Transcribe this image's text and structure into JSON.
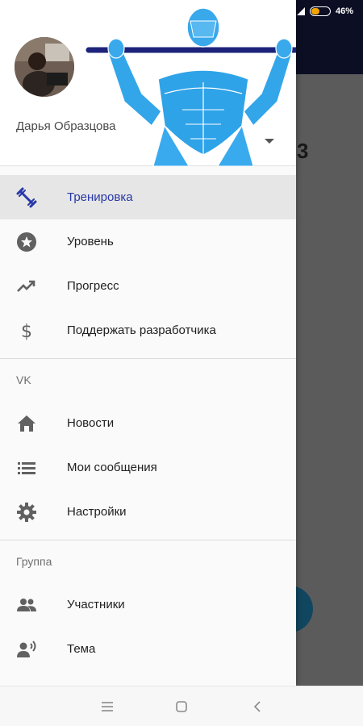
{
  "status_bar": {
    "battery": "46%",
    "battery_level": 0.46
  },
  "background": {
    "partial_number": "3",
    "toolbar_color": "#1d2256",
    "fab_color": "#2aa6e5"
  },
  "drawer": {
    "user_name": "Дарья Образцова",
    "accent_color": "#2838a8",
    "items_main": [
      {
        "label": "Тренировка",
        "icon": "dumbbell-icon",
        "active": true
      },
      {
        "label": "Уровень",
        "icon": "star-circle-icon",
        "active": false
      },
      {
        "label": "Прогресс",
        "icon": "trending-up-icon",
        "active": false
      },
      {
        "label": "Поддержать разработчика",
        "icon": "dollar-icon",
        "active": false
      }
    ],
    "section_vk": "VK",
    "items_vk": [
      {
        "label": "Новости",
        "icon": "home-icon"
      },
      {
        "label": "Мои сообщения",
        "icon": "list-icon"
      },
      {
        "label": "Настройки",
        "icon": "gear-icon"
      }
    ],
    "section_group": "Группа",
    "items_group": [
      {
        "label": "Участники",
        "icon": "people-icon"
      },
      {
        "label": "Тема",
        "icon": "speaker-person-icon"
      }
    ]
  },
  "navbar": {
    "buttons": [
      "menu-button",
      "home-button",
      "back-button"
    ]
  }
}
